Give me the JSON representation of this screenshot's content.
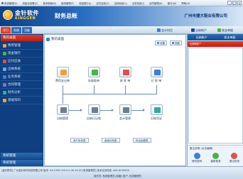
{
  "menubar": {
    "items": [
      "系统管理(Z)",
      "初始化设置(C)",
      "基本档案(B)",
      "费用管理(F)",
      "现金银行(J)",
      "应付应收(Y)",
      "出纳系统(L)",
      "业务系统(I)",
      "合同管理(A)",
      "窗口(W)",
      "帮助(H)"
    ],
    "window_buttons": [
      "_",
      "□",
      "×"
    ]
  },
  "header": {
    "logo_cn": "金针软件",
    "logo_en": "KINGGEN",
    "product": "财务总帐",
    "company": "广州市捷大鞋业有限公司"
  },
  "toolbar": {
    "side_tabs": [
      "导引",
      "系统",
      "功能"
    ],
    "lock_label": "会计科目",
    "out_account_label": "出纳帐户",
    "receipt_label": "收支单据"
  },
  "sidebar": {
    "header": "我的桌面",
    "items": [
      {
        "label": "费用管理",
        "icon": "expense-icon",
        "color": "#e9a23b"
      },
      {
        "label": "现金银行",
        "icon": "bank-icon",
        "color": "#4fb04a"
      },
      {
        "label": "应付应收",
        "icon": "ledger-icon",
        "color": "#d9534f"
      },
      {
        "label": "出纳系统",
        "icon": "cashier-icon",
        "color": "#6aa7e6"
      },
      {
        "label": "业务系统",
        "icon": "business-icon",
        "color": "#3f7fd0"
      },
      {
        "label": "合同管理",
        "icon": "contract-icon",
        "color": "#8b6ccf"
      },
      {
        "label": "财务分析",
        "icon": "analysis-icon",
        "color": "#3aa7a1"
      },
      {
        "label": "基础资料",
        "icon": "base-data-icon",
        "color": "#e9a23b"
      }
    ],
    "bottom_1": "系统管理",
    "bottom_2": "系统管理"
  },
  "main": {
    "title": "我的桌面",
    "setting_label": "设置",
    "view_label": "视图",
    "nodes": {
      "expense": {
        "label": "费用支出单",
        "color": "#e9a23b"
      },
      "deposit": {
        "label": "存取款单",
        "color": "#4fb04a"
      },
      "receipt": {
        "label": "收 款 单",
        "color": "#d9534f"
      },
      "payment": {
        "label": "付 款 单",
        "color": "#3f7fd0"
      },
      "cashier_mgmt": {
        "label": "出纳管理",
        "color": "#6f7d8c"
      },
      "cashier_journal": {
        "label": "出纳日记账",
        "color": "#6f7d8c"
      },
      "accounting": {
        "label": "会计管理",
        "color": "#6f7d8c"
      },
      "voucher": {
        "label": "记账凭证",
        "color": "#3aa7a1"
      }
    },
    "reports": [
      "资产负债表",
      "费用分析表",
      "科目余额表"
    ]
  },
  "rpanel": {
    "tabs": [
      "出纳帐户",
      "收支单据"
    ],
    "sub_header": "出纳帐户",
    "note": "备注说明 (点击编辑)",
    "actions": [
      {
        "label": "修改密码",
        "color": "#3f7fd0"
      },
      {
        "label": "重新登录",
        "color": "#4fb04a"
      },
      {
        "label": "退出系统",
        "color": "#d9534f"
      }
    ]
  },
  "status": {
    "line1": "[金针财务] 广州金针软件科技有限公司 版本: V4.0.052    2013-2-28 14:20    [系统管理员]    技术支持热线: 400-6219925",
    "line2": "操作员: 系统管理员    [帐套]    用户: 系统管理员"
  }
}
